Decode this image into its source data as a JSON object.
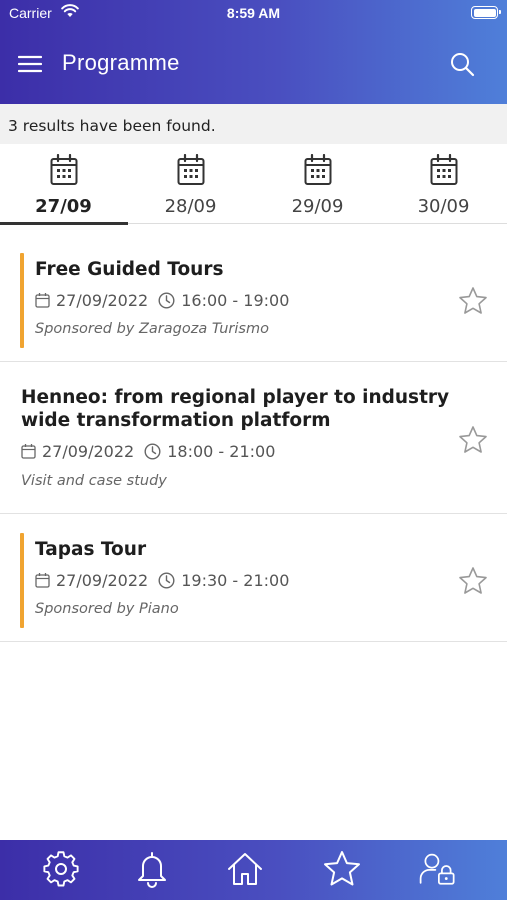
{
  "status_bar": {
    "carrier": "Carrier",
    "time": "8:59 AM"
  },
  "header": {
    "title": "Programme"
  },
  "results": {
    "text": "3 results have been found."
  },
  "tabs": [
    {
      "label": "27/09",
      "active": true
    },
    {
      "label": "28/09",
      "active": false
    },
    {
      "label": "29/09",
      "active": false
    },
    {
      "label": "30/09",
      "active": false
    }
  ],
  "events": [
    {
      "title": "Free Guided Tours",
      "date": "27/09/2022",
      "time": "16:00 - 19:00",
      "subtitle": "Sponsored by Zaragoza Turismo",
      "sponsored": true,
      "favorite": false
    },
    {
      "title_line1": "Henneo: from regional player to industry",
      "title_line2": "wide transformation platform",
      "date": "27/09/2022",
      "time": "18:00 - 21:00",
      "subtitle": "Visit and case study",
      "sponsored": false,
      "favorite": false
    },
    {
      "title": "Tapas Tour",
      "date": "27/09/2022",
      "time": "19:30 - 21:00",
      "subtitle": "Sponsored by Piano",
      "sponsored": true,
      "favorite": false
    }
  ],
  "bottom_nav": {
    "items": [
      "gear-icon",
      "bell-icon",
      "home-icon",
      "star-icon",
      "user-lock-icon"
    ]
  },
  "colors": {
    "header_gradient_start": "#3c2ea8",
    "header_gradient_end": "#4f7fd9",
    "accent": "#f0a431",
    "results_bar": "#f1f1f1"
  }
}
